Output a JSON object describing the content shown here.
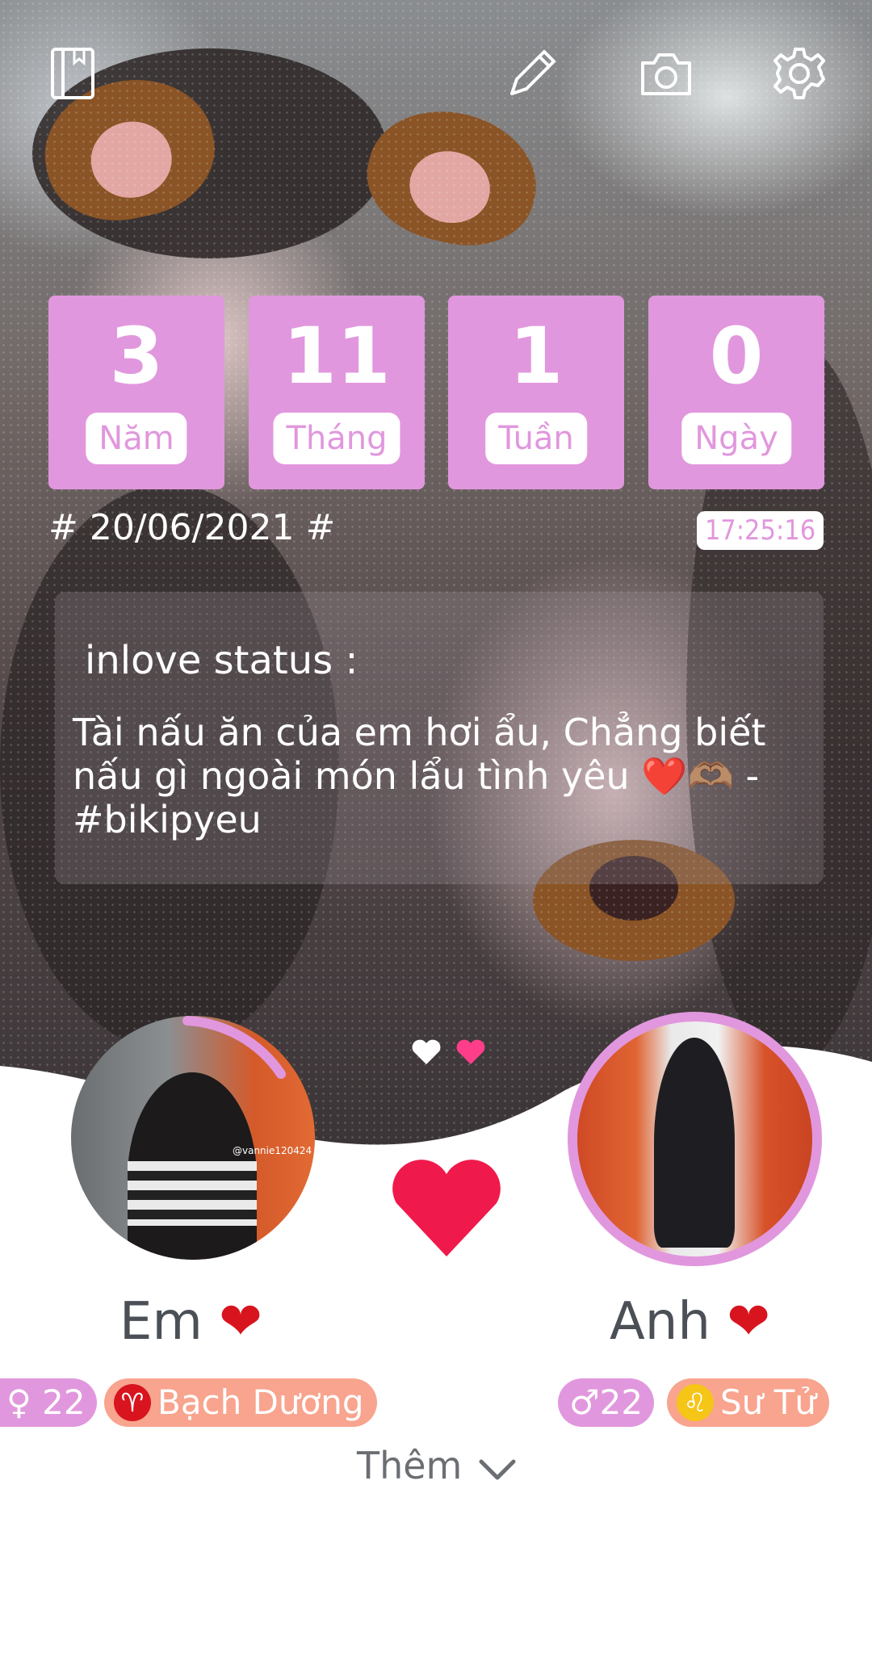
{
  "toolbar": {
    "icons": [
      "book-icon",
      "pencil-icon",
      "camera-icon",
      "gear-icon"
    ]
  },
  "counter": [
    {
      "value": "3",
      "unit": "Năm"
    },
    {
      "value": "11",
      "unit": "Tháng"
    },
    {
      "value": "1",
      "unit": "Tuần"
    },
    {
      "value": "0",
      "unit": "Ngày"
    }
  ],
  "start_date": "# 20/06/2021 #",
  "clock": "17:25:16",
  "status": {
    "title": "inlove status :",
    "text": "Tài nấu ăn của em hơi ẩu,  Chẳng biết nấu gì ngoài món lẩu tình yêu ❤️🫶🏽 - #bikipyeu"
  },
  "partners": {
    "left": {
      "name": "Em",
      "heart": "❤",
      "age": "♀ 22",
      "zodiac_symbol": "♈",
      "zodiac": "Bạch Dương",
      "photo_caption": "@vannie120424"
    },
    "right": {
      "name": "Anh",
      "heart": "❤",
      "age": "♂22",
      "zodiac_symbol": "♌",
      "zodiac": "Sư Tử"
    }
  },
  "more_label": "Thêm",
  "colors": {
    "accent_pink": "#e197dd",
    "heart_red": "#ef1a4b",
    "zodiac_orange": "#f8a48e",
    "text_gray": "#4b5057"
  }
}
